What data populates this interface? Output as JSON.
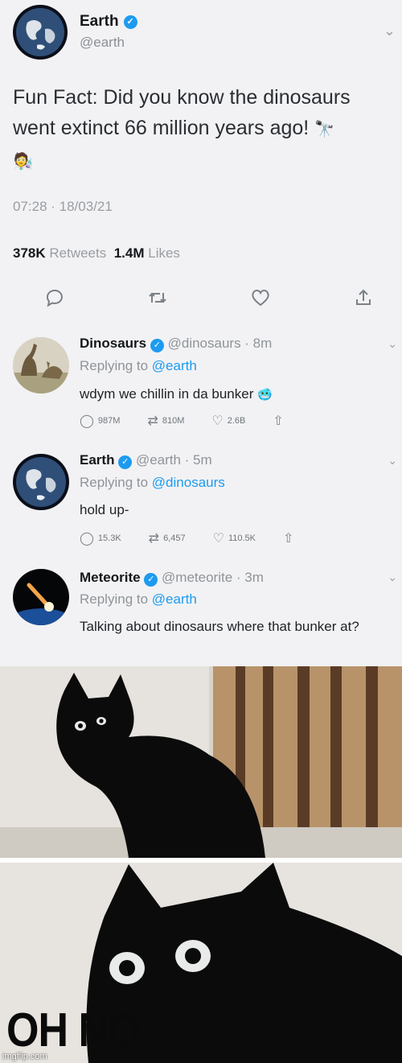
{
  "main_tweet": {
    "name": "Earth",
    "handle": "@earth",
    "text_line1": "Fun Fact: Did you know the dinosaurs",
    "text_line2": "went extinct 66 million years ago! ",
    "time": "07:28 · 18/03/21",
    "retweets_count": "378K",
    "retweets_label": "Retweets",
    "likes_count": "1.4M",
    "likes_label": "Likes",
    "actions": [
      "reply-icon",
      "retweet-icon",
      "like-icon",
      "share-icon"
    ]
  },
  "replies": [
    {
      "name": "Dinosaurs",
      "handle": "@dinosaurs · 8m",
      "replying_prefix": "Replying to",
      "replying_to": "@earth",
      "text": "wdym we chillin in da bunker",
      "reply_count": "987M",
      "retweet_count": "810M",
      "like_count": "2.6B"
    },
    {
      "name": "Earth",
      "handle": "@earth · 5m",
      "replying_prefix": "Replying to",
      "replying_to": "@dinosaurs",
      "text": "hold up-",
      "reply_count": "15.3K",
      "retweet_count": "6,457",
      "like_count": "110.5K"
    },
    {
      "name": "Meteorite",
      "handle": "@meteorite · 3m",
      "replying_prefix": "Replying to",
      "replying_to": "@earth",
      "text": "Talking about dinosaurs where that bunker at?"
    }
  ],
  "meme": {
    "caption": "OH NO",
    "watermark": "imgflip.com"
  },
  "colors": {
    "twitter_blue": "#1d9bf0",
    "muted_text": "#8f9499",
    "background": "#f2f2f4"
  }
}
